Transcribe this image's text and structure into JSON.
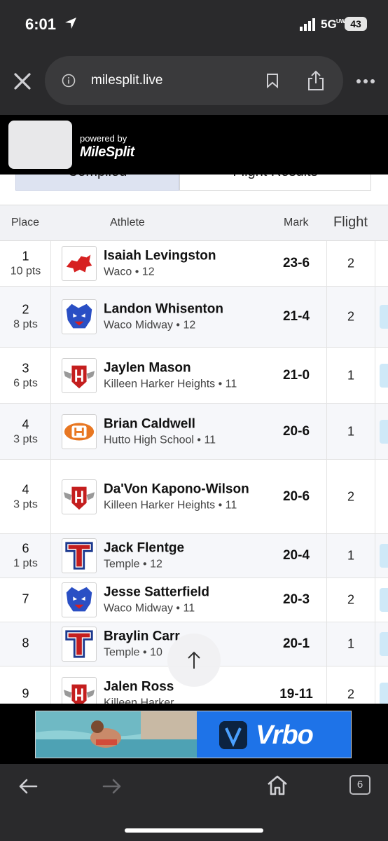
{
  "status_bar": {
    "time": "6:01",
    "network": "5G",
    "network_sub": "UW",
    "battery": "43"
  },
  "browser": {
    "url": "milesplit.live",
    "tab_count": "6"
  },
  "header": {
    "powered_by": "powered by",
    "brand": "MileSplit"
  },
  "tabs": {
    "compiled": "Compiled",
    "flight": "Flight Results"
  },
  "table": {
    "columns": {
      "place": "Place",
      "athlete": "Athlete",
      "mark": "Mark",
      "flight": "Flight"
    },
    "rows": [
      {
        "place": "1",
        "pts": "10 pts",
        "name": "Isaiah Levingston",
        "team": "Waco • 12",
        "mark": "23-6",
        "flight": "2",
        "logo": "lion-logo"
      },
      {
        "place": "2",
        "pts": "8 pts",
        "name": "Landon Whisenton",
        "team": "Waco Midway • 12",
        "mark": "21-4",
        "flight": "2",
        "logo": "panther-logo"
      },
      {
        "place": "3",
        "pts": "6 pts",
        "name": "Jaylen Mason",
        "team": "Killeen Harker Heights • 11",
        "mark": "21-0",
        "flight": "1",
        "logo": "winged-h-logo"
      },
      {
        "place": "4",
        "pts": "3 pts",
        "name": "Brian Caldwell",
        "team": "Hutto High School • 11",
        "mark": "20-6",
        "flight": "1",
        "logo": "hutto-logo"
      },
      {
        "place": "4",
        "pts": "3 pts",
        "name": "Da'Von Kapono-Wilson",
        "team": "Killeen Harker Heights • 11",
        "mark": "20-6",
        "flight": "2",
        "logo": "winged-h-logo"
      },
      {
        "place": "6",
        "pts": "1 pts",
        "name": "Jack Flentge",
        "team": "Temple • 12",
        "mark": "20-4",
        "flight": "1",
        "logo": "temple-t-logo"
      },
      {
        "place": "7",
        "pts": "",
        "name": "Jesse Satterfield",
        "team": "Waco Midway • 11",
        "mark": "20-3",
        "flight": "2",
        "logo": "panther-logo"
      },
      {
        "place": "8",
        "pts": "",
        "name": "Braylin Carr",
        "team": "Temple • 10",
        "mark": "20-1",
        "flight": "1",
        "logo": "temple-t-logo"
      },
      {
        "place": "9",
        "pts": "",
        "name": "Jalen Ross",
        "team": "Killeen Harker",
        "mark": "19-11",
        "flight": "2",
        "logo": "winged-h-logo"
      }
    ]
  },
  "ad": {
    "brand": "Vrbo"
  },
  "colors": {
    "accent": "#1e73e8",
    "header_bg": "#000000",
    "tab_active": "#dde3f1"
  }
}
